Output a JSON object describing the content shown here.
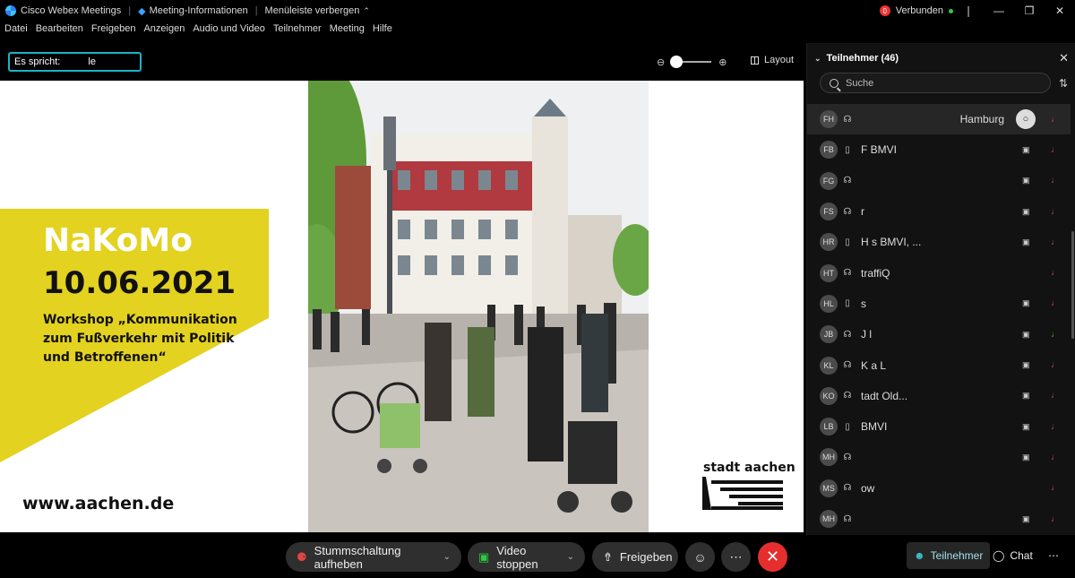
{
  "titlebar": {
    "app_name": "Cisco Webex Meetings",
    "meeting_info": "Meeting-Informationen",
    "hide_menu": "Menüleiste verbergen",
    "status_count": "0",
    "connection": "Verbunden"
  },
  "menu": [
    "Datei",
    "Bearbeiten",
    "Freigeben",
    "Anzeigen",
    "Audio und Video",
    "Teilnehmer",
    "Meeting",
    "Hilfe"
  ],
  "speaking": {
    "label": "Es spricht:",
    "name": "le"
  },
  "view": {
    "layout": "Layout"
  },
  "slide": {
    "title": "NaKoMo",
    "date": "10.06.2021",
    "description": "Workshop „Kommunikation zum Fußverkehr mit Politik und Betroffenen“",
    "url": "www.aachen.de",
    "logo": "stadt aachen"
  },
  "toolbar": {
    "unmute": "Stummschaltung aufheben",
    "video": "Video stoppen",
    "share": "Freigeben",
    "participants": "Teilnehmer",
    "chat": "Chat"
  },
  "panel": {
    "title": "Teilnehmer (46)",
    "search_placeholder": "Suche",
    "participants": [
      {
        "initials": "FH",
        "name": "Hamburg",
        "device": "headset",
        "video": false,
        "mic": "muted",
        "active": true
      },
      {
        "initials": "FB",
        "name": "F BMVI",
        "device": "phone",
        "video": true,
        "mic": "muted"
      },
      {
        "initials": "FG",
        "name": "",
        "device": "headset",
        "video": true,
        "mic": "muted"
      },
      {
        "initials": "FS",
        "name": "r",
        "device": "headset",
        "video": true,
        "mic": "muted"
      },
      {
        "initials": "HR",
        "name": "H s BMVI, ...",
        "device": "phone",
        "video": true,
        "mic": "muted"
      },
      {
        "initials": "HT",
        "name": "traffiQ",
        "device": "headset",
        "video": false,
        "mic": "muted"
      },
      {
        "initials": "HL",
        "name": "s",
        "device": "phone",
        "video": true,
        "mic": "muted"
      },
      {
        "initials": "JB",
        "name": "J l",
        "device": "headset",
        "video": true,
        "mic": "on"
      },
      {
        "initials": "KL",
        "name": "K a L",
        "device": "headset",
        "video": true,
        "mic": "muted"
      },
      {
        "initials": "KO",
        "name": "tadt Old...",
        "device": "headset",
        "video": true,
        "mic": "muted"
      },
      {
        "initials": "LB",
        "name": "BMVI",
        "device": "phone",
        "video": true,
        "mic": "muted"
      },
      {
        "initials": "MH",
        "name": "",
        "device": "headset",
        "video": true,
        "mic": "muted"
      },
      {
        "initials": "MS",
        "name": "ow",
        "device": "headset",
        "video": false,
        "mic": "muted"
      },
      {
        "initials": "MH",
        "name": "",
        "device": "headset",
        "video": true,
        "mic": "muted"
      }
    ]
  },
  "colors": {
    "accent": "#1ab3c8",
    "leave": "#e62e2e",
    "slide_yellow": "#e3d21f",
    "muted": "#e34444"
  }
}
